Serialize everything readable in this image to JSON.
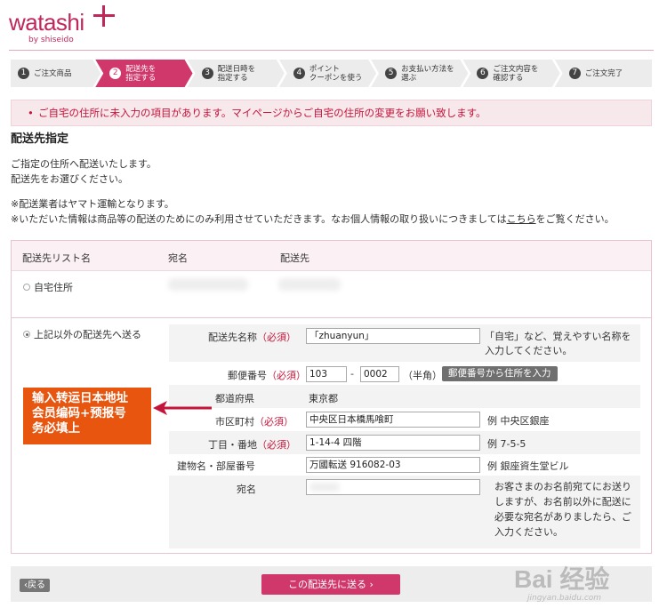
{
  "brand": {
    "wordmark": "watashi",
    "byline": "by shiseido"
  },
  "steps": [
    {
      "num": "1",
      "label": "ご注文商品"
    },
    {
      "num": "2",
      "label": "配送先を\n指定する",
      "active": true
    },
    {
      "num": "3",
      "label": "配送日時を\n指定する"
    },
    {
      "num": "4",
      "label": "ポイント\nクーポンを使う"
    },
    {
      "num": "5",
      "label": "お支払い方法を\n選ぶ"
    },
    {
      "num": "6",
      "label": "ご注文内容を\n確認する"
    },
    {
      "num": "7",
      "label": "ご注文完了"
    }
  ],
  "alert": "ご自宅の住所に未入力の項目があります。マイページからご自宅の住所の変更をお願い致します。",
  "page_title": "配送先指定",
  "intro": {
    "line1": "ご指定の住所へ配送いたします。",
    "line2": "配送先をお選びください。",
    "note1": "※配送業者はヤマト運輸となります。",
    "note2": "※いただいた情報は商品等の配送のためにのみ利用させていただきます。なお個人情報の取り扱いにつきましては",
    "note2_link": "こちら",
    "note2_end": "をご覧ください。"
  },
  "table_head": {
    "col1": "配送先リスト名",
    "col2": "宛名",
    "col3": "配送先"
  },
  "option_home": "自宅住所",
  "option_other": "上記以外の配送先へ送る",
  "required": "（必須）",
  "form": {
    "name_label": "配送先名称",
    "name_value": "「zhuanyun」",
    "name_hint1": "「自宅」など、覚えやすい名称を",
    "name_hint2": "入力してください。",
    "zip_label": "郵便番号",
    "zip1": "103",
    "zip_dash": "-",
    "zip2": "0002",
    "zip_note": "（半角）",
    "zip_button": "郵便番号から住所を入力",
    "pref_label": "都道府県",
    "pref_value": "東京都",
    "city_label": "市区町村",
    "city_value": "中央区日本橋馬喰町",
    "city_hint": "例 中央区銀座",
    "street_label": "丁目・番地",
    "street_value": "1-14-4 四階",
    "street_hint": "例 7-5-5",
    "building_label": "建物名・部屋番号",
    "building_value": "万國転送 916082-03",
    "building_hint": "例 銀座資生堂ビル",
    "addressee_label": "宛名",
    "addressee_hint1": "お客さまのお名前宛てにお送り",
    "addressee_hint2": "しますが、お名前以外に配送に",
    "addressee_hint3": "必要な宛名がありましたら、ご",
    "addressee_hint4": "入力ください。"
  },
  "callout": {
    "line1": "输入转运日本地址",
    "line2": "会员编码+预报号",
    "line3": "务必填上"
  },
  "buttons": {
    "back": "‹戻る",
    "submit": "この配送先に送る ›"
  },
  "watermark": {
    "main": "Bai 经验",
    "sub": "jingyan.baidu.com"
  },
  "colors": {
    "accent": "#d0386b",
    "alert_text": "#c4143a",
    "callout": "#e8550f"
  }
}
